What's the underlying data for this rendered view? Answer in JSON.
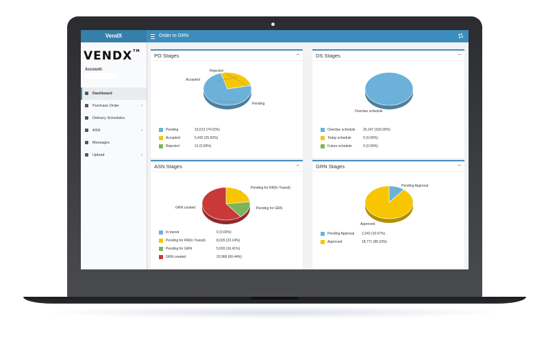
{
  "app": {
    "brand": "VendX",
    "logo_text": "VENDX",
    "logo_tm": "TM",
    "module_title": "Order to GRN"
  },
  "account": {
    "label": "Account:",
    "value": ""
  },
  "sidebar": {
    "items": [
      {
        "label": "Dashboard",
        "icon": "dashboard-icon",
        "active": true,
        "has_caret": false
      },
      {
        "label": "Purchase Order",
        "icon": "document-icon",
        "active": false,
        "has_caret": true
      },
      {
        "label": "Delivery Schedules",
        "icon": "calendar-icon",
        "active": false,
        "has_caret": false
      },
      {
        "label": "ASN",
        "icon": "truck-icon",
        "active": false,
        "has_caret": true
      },
      {
        "label": "Messages",
        "icon": "envelope-icon",
        "active": false,
        "has_caret": false
      },
      {
        "label": "Upload",
        "icon": "upload-icon",
        "active": false,
        "has_caret": true
      }
    ]
  },
  "panels": {
    "po": {
      "title": "PO Stages",
      "collapse": "–"
    },
    "ds": {
      "title": "DS Stages",
      "collapse": "–"
    },
    "asn": {
      "title": "ASN Stages",
      "collapse": "–"
    },
    "grn": {
      "title": "GRN Stages",
      "collapse": "–"
    }
  },
  "chart_data": [
    {
      "id": "po",
      "type": "pie",
      "title": "PO Stages",
      "slices": [
        {
          "name": "Pending",
          "value": 15513,
          "legend_text": "15,513 (74.02%)",
          "color": "#6bb1d9"
        },
        {
          "name": "Accepted",
          "value": 5432,
          "legend_text": "5,432 (25.92%)",
          "color": "#f7c600"
        },
        {
          "name": "Rejected",
          "value": 13,
          "legend_text": "13 (0.06%)",
          "color": "#7cb45a"
        }
      ]
    },
    {
      "id": "ds",
      "type": "pie",
      "title": "DS Stages",
      "slices": [
        {
          "name": "Overdue schedule",
          "value": 20147,
          "legend_text": "20,147 (100.00%)",
          "color": "#6bb1d9"
        },
        {
          "name": "Today schedule",
          "value": 0,
          "legend_text": "0 (0.00%)",
          "color": "#f7c600"
        },
        {
          "name": "Future schedule",
          "value": 0,
          "legend_text": "0 (0.00%)",
          "color": "#7cb45a"
        }
      ]
    },
    {
      "id": "asn",
      "type": "pie",
      "title": "ASN Stages",
      "slices": [
        {
          "name": "In transit",
          "value": 0,
          "legend_text": "0 (0.00%)",
          "color": "#6bb1d9"
        },
        {
          "name": "Pending for RR(In Transit)",
          "value": 8029,
          "legend_text": "8,029 (23.14%)",
          "color": "#f7c600"
        },
        {
          "name": "Pending for GRN",
          "value": 5693,
          "legend_text": "5,693 (16.41%)",
          "color": "#7cb45a"
        },
        {
          "name": "GRN created",
          "value": 20968,
          "legend_text": "20,968 (60.44%)",
          "color": "#c9393a"
        }
      ]
    },
    {
      "id": "grn",
      "type": "pie",
      "title": "GRN Stages",
      "slices": [
        {
          "name": "Pending Approval",
          "value": 2242,
          "legend_text": "2,242 (10.67%)",
          "color": "#6bb1d9"
        },
        {
          "name": "Approved",
          "value": 18771,
          "legend_text": "18,771 (89.33%)",
          "color": "#f7c600"
        }
      ]
    }
  ]
}
